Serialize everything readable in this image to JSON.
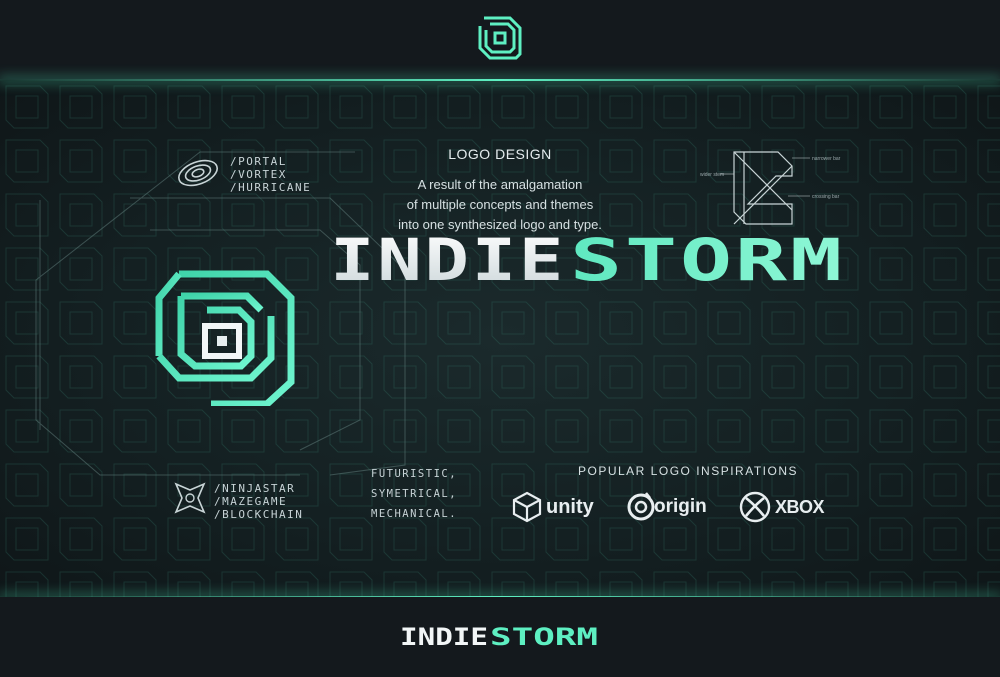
{
  "brand": {
    "name_part1": "INDIE",
    "name_part2": "STORM",
    "accent_color": "#5ef0c2",
    "light_color": "#f2f6f7",
    "background_color": "#13181c",
    "logo_icon": "spiral-square-logo-icon"
  },
  "concepts": {
    "portal_tags": [
      "/PORTAL",
      "/VORTEX",
      "/HURRICANE"
    ],
    "portal_icon": "swirl-vortex-icon",
    "ninja_tags": [
      "/NINJASTAR",
      "/MAZEGAME",
      "/BLOCKCHAIN"
    ],
    "ninja_icon": "ninja-star-icon"
  },
  "design": {
    "title": "LOGO DESIGN",
    "description_lines": [
      "A result of the amalgamation",
      "of multiple concepts and themes",
      "into one synthesized logo and type."
    ]
  },
  "construction_diagram": {
    "labels": [
      "narrower bar",
      "wider stem",
      "crossing bar"
    ]
  },
  "traits": [
    "FUTURISTIC,",
    "SYMETRICAL,",
    "MECHANICAL."
  ],
  "inspirations": {
    "title": "POPULAR LOGO INSPIRATIONS",
    "brands": [
      {
        "name": "unity",
        "icon": "unity-cube-icon"
      },
      {
        "name": "origin",
        "icon": "origin-ring-icon"
      },
      {
        "name": "XBOX",
        "icon": "xbox-sphere-icon"
      }
    ]
  }
}
